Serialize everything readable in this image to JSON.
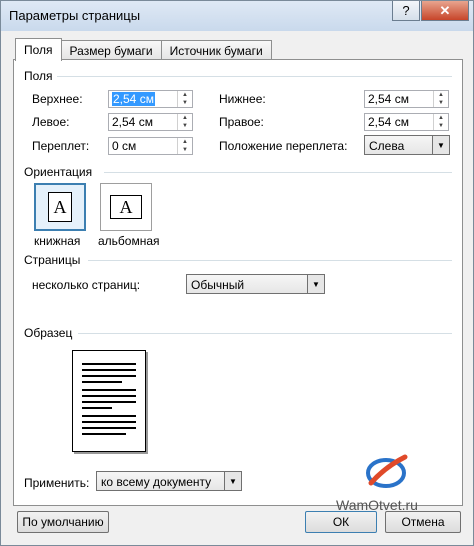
{
  "window": {
    "title": "Параметры страницы",
    "help": "?",
    "close": "✕"
  },
  "tabs": [
    {
      "label": "Поля",
      "active": true
    },
    {
      "label": "Размер бумаги",
      "active": false
    },
    {
      "label": "Источник бумаги",
      "active": false
    }
  ],
  "margins": {
    "group_label": "Поля",
    "top": {
      "label": "Верхнее:",
      "value": "2,54 см"
    },
    "bottom": {
      "label": "Нижнее:",
      "value": "2,54 см"
    },
    "left": {
      "label": "Левое:",
      "value": "2,54 см"
    },
    "right": {
      "label": "Правое:",
      "value": "2,54 см"
    },
    "gutter": {
      "label": "Переплет:",
      "value": "0 см"
    },
    "gutter_pos": {
      "label": "Положение переплета:",
      "value": "Слева"
    }
  },
  "orientation": {
    "group_label": "Ориентация",
    "portrait": "книжная",
    "landscape": "альбомная",
    "glyph": "A",
    "selected": "portrait"
  },
  "pages": {
    "group_label": "Страницы",
    "multiple_label": "несколько страниц:",
    "multiple_value": "Обычный"
  },
  "preview": {
    "group_label": "Образец"
  },
  "apply": {
    "label": "Применить:",
    "value": "ко всему документу"
  },
  "buttons": {
    "default": "По умолчанию",
    "ok": "ОК",
    "cancel": "Отмена"
  },
  "watermark": "WamOtvet.ru",
  "colors": {
    "accent": "#3c7fb1",
    "selection": "#3399ff",
    "close": "#c7452a"
  }
}
